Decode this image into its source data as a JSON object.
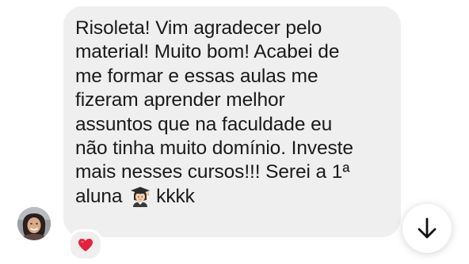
{
  "message": {
    "lines": [
      "Risoleta! Vim agradecer pelo",
      "material! Muito bom! Acabei de",
      "me formar e essas aulas me",
      "fizeram aprender melhor",
      "assuntos que na faculdade eu",
      "não tinha muito domínio. Investe",
      "mais nesses cursos!!! Serei a 1ª"
    ],
    "last_line_before_emoji": "aluna",
    "last_line_after_emoji": "kkkk",
    "inline_emoji": "woman-student-emoji"
  },
  "reaction": {
    "emoji": "heart-icon",
    "color": "#e8203a"
  },
  "avatar": {
    "icon": "user-avatar"
  },
  "scroll_button": {
    "icon": "arrow-down-icon"
  },
  "colors": {
    "bubble": "#efefef",
    "text": "#1a1a1a",
    "background": "#ffffff"
  }
}
